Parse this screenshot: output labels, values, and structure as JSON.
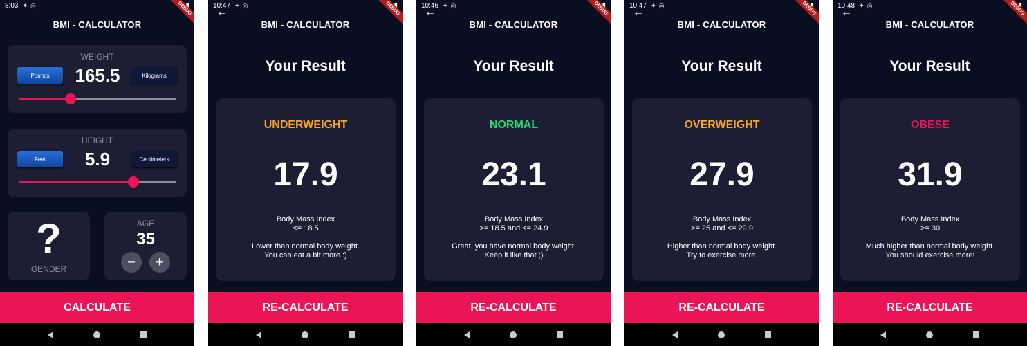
{
  "debug_label": "DEBUG",
  "app_title": "BMI - CALCULATOR",
  "input_screen": {
    "time": "8:03",
    "weight": {
      "label": "WEIGHT",
      "value": "165.5",
      "unit_left": "Pounds",
      "unit_right": "Kilograms",
      "slider_fraction": 0.33
    },
    "height": {
      "label": "HEIGHT",
      "value": "5.9",
      "unit_left": "Feet",
      "unit_right": "Centimeters",
      "slider_fraction": 0.73
    },
    "gender": {
      "symbol": "?",
      "label": "GENDER"
    },
    "age": {
      "label": "AGE",
      "value": "35",
      "minus": "−",
      "plus": "+"
    },
    "button": "CALCULATE"
  },
  "results": [
    {
      "time": "10:47",
      "heading": "Your Result",
      "category": "UNDERWEIGHT",
      "color": "#f5a623",
      "bmi": "17.9",
      "index_label": "Body Mass Index",
      "range": "<= 18.5",
      "message_1": "Lower than normal body weight.",
      "message_2": "You can eat a bit more :)",
      "button": "RE-CALCULATE"
    },
    {
      "time": "10:46",
      "heading": "Your Result",
      "category": "NORMAL",
      "color": "#24d876",
      "bmi": "23.1",
      "index_label": "Body Mass Index",
      "range": ">= 18.5 and <= 24.9",
      "message_1": "Great, you have normal body weight.",
      "message_2": "Keep it like that ;)",
      "button": "RE-CALCULATE"
    },
    {
      "time": "10:47",
      "heading": "Your Result",
      "category": "OVERWEIGHT",
      "color": "#f5a623",
      "bmi": "27.9",
      "index_label": "Body Mass Index",
      "range": ">= 25 and <= 29.9",
      "message_1": "Higher than normal body weight.",
      "message_2": "Try to exercise more.",
      "button": "RE-CALCULATE"
    },
    {
      "time": "10:48",
      "heading": "Your Result",
      "category": "OBESE",
      "color": "#eb1555",
      "bmi": "31.9",
      "index_label": "Body Mass Index",
      "range": ">= 30",
      "message_1": "Much higher than normal body weight.",
      "message_2": "You should exercise more!",
      "button": "RE-CALCULATE"
    }
  ]
}
